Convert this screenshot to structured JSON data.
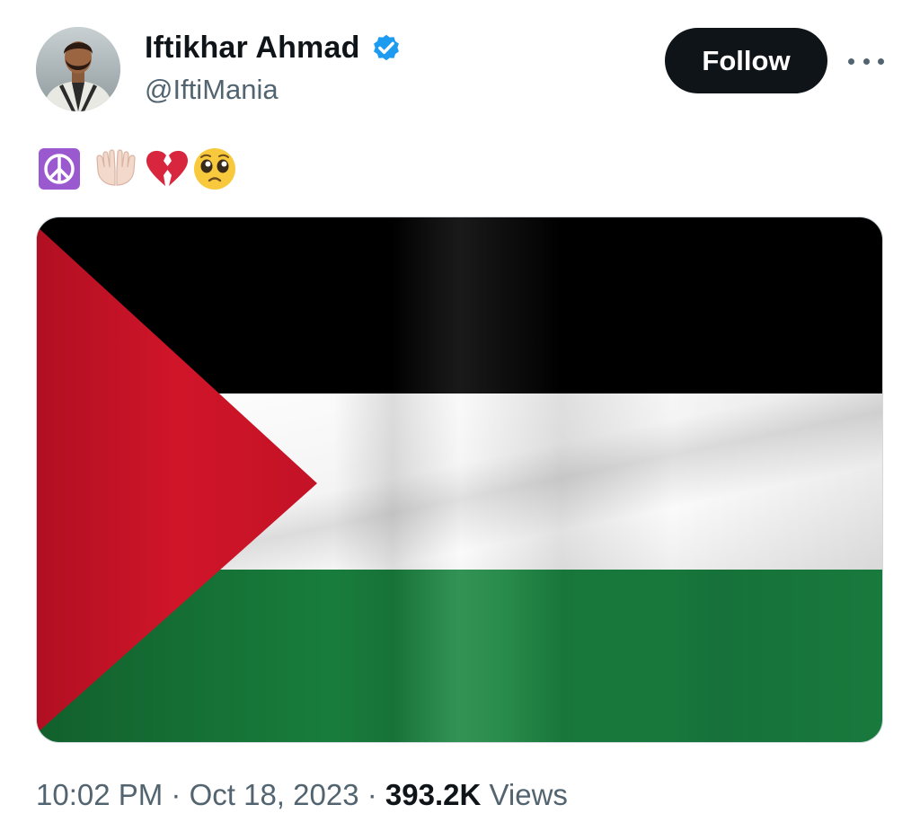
{
  "author": {
    "name": "Iftikhar Ahmad",
    "handle": "@IftiMania",
    "verified": true,
    "verified_color": "#1d9bf0"
  },
  "actions": {
    "follow_label": "Follow",
    "more_icon": "more-horizontal-icon"
  },
  "tweet": {
    "emojis": [
      "peace-symbol",
      "palms-up-together",
      "broken-heart",
      "pleading-face"
    ],
    "media": {
      "type": "image",
      "subject": "palestine-flag",
      "colors": {
        "black": "#000000",
        "white": "#ffffff",
        "green": "#17793a",
        "red": "#ce1126"
      }
    }
  },
  "meta": {
    "time": "10:02 PM",
    "separator": "·",
    "date": "Oct 18, 2023",
    "views_count": "393.2K",
    "views_label": "Views"
  },
  "colors": {
    "text_primary": "#0f1419",
    "text_secondary": "#536471",
    "button_bg": "#0f1419",
    "border": "#cfd9de"
  }
}
